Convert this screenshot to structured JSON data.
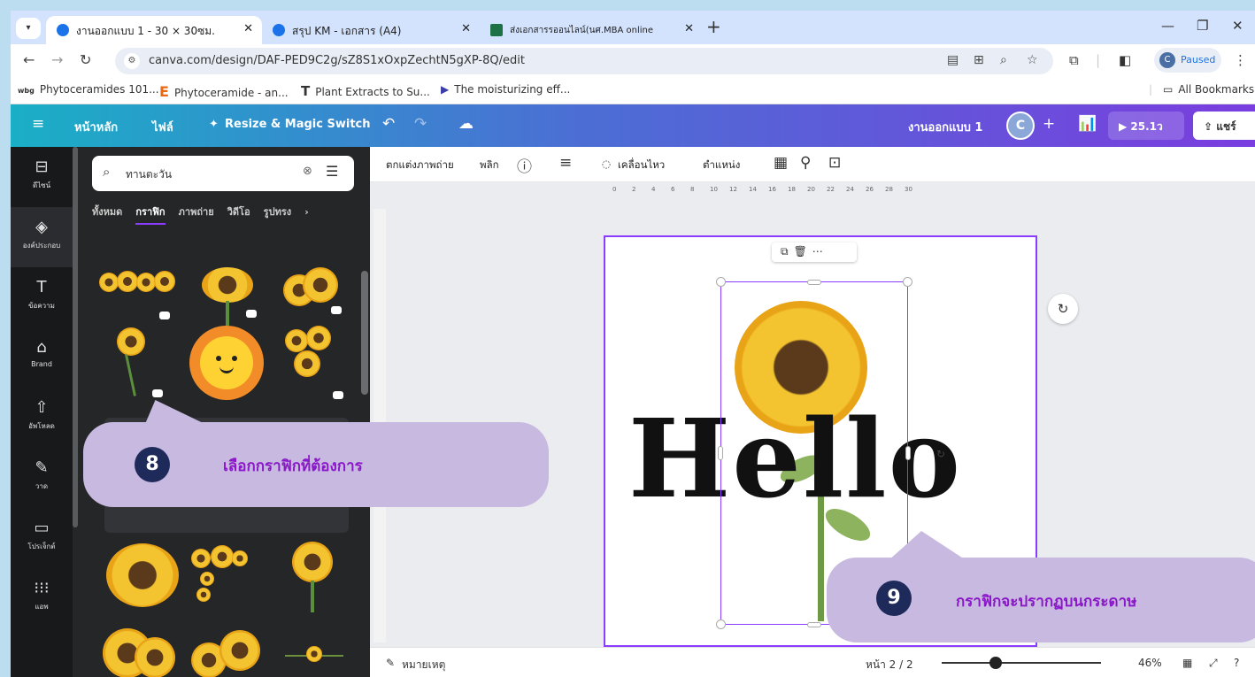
{
  "browser": {
    "tabs": [
      {
        "title": "งานออกแบบ 1 - 30 × 30ซม.",
        "active": true
      },
      {
        "title": "สรุป KM - เอกสาร (A4)",
        "active": false
      },
      {
        "title": "ส่งเอกสารรออนไลน์(นศ.MBA online",
        "active": false
      }
    ],
    "url": "canva.com/design/DAF-PED9C2g/sZ8S1xOxpZechtN5gXP-8Q/edit",
    "profile_status": "Paused",
    "profile_initial": "C",
    "bookmarks": [
      {
        "icon": "wbg",
        "label": "Phytoceramides 101..."
      },
      {
        "icon": "E",
        "label": "Phytoceramide - an..."
      },
      {
        "icon": "T",
        "label": "Plant Extracts to Su..."
      },
      {
        "icon": "▶",
        "label": "The moisturizing eff..."
      }
    ],
    "all_bookmarks": "All Bookmarks"
  },
  "canva": {
    "header": {
      "home": "หน้าหลัก",
      "file": "ไฟล์",
      "resize": "Resize & Magic Switch",
      "design_name": "งานออกแบบ 1",
      "avatar_initial": "C",
      "timer": "25.1ว",
      "share": "แชร์"
    },
    "rail": [
      {
        "icon": "template-icon",
        "label": "ดีไซน์"
      },
      {
        "icon": "elements-icon",
        "label": "องค์ประกอบ",
        "active": true
      },
      {
        "icon": "text-icon",
        "label": "ข้อความ"
      },
      {
        "icon": "brand-icon",
        "label": "Brand"
      },
      {
        "icon": "upload-icon",
        "label": "อัพโหลด"
      },
      {
        "icon": "draw-icon",
        "label": "วาด"
      },
      {
        "icon": "projects-icon",
        "label": "โปรเจ็กต์"
      },
      {
        "icon": "apps-icon",
        "label": "แอพ"
      }
    ],
    "search": {
      "value": "ทานตะวัน"
    },
    "categories": [
      "ทั้งหมด",
      "กราฟิก",
      "ภาพถ่าย",
      "วิดีโอ",
      "รูปทรง"
    ],
    "active_category": "กราฟิก",
    "toolbar": {
      "edit_photo": "ตกแต่งภาพถ่าย",
      "flip": "พลิก",
      "animate": "เคลื่อนไหว",
      "position": "ตำแหน่ง"
    },
    "ruler_ticks": [
      "0",
      "2",
      "4",
      "6",
      "8",
      "10",
      "12",
      "14",
      "16",
      "18",
      "20",
      "22",
      "24",
      "26",
      "28",
      "30"
    ],
    "canvas_text": "Hello",
    "footer": {
      "notes": "หมายเหตุ",
      "page": "หน้า 2 / 2",
      "zoom": "46%"
    }
  },
  "callouts": [
    {
      "number": "8",
      "text": "เลือกกราฟิกที่ต้องการ"
    },
    {
      "number": "9",
      "text": "กราฟิกจะปรากฏบนกระดาษ"
    }
  ],
  "colors": {
    "canva_gradient_start": "#1aafc6",
    "canva_gradient_end": "#7a3ddf",
    "selection": "#8b3dff",
    "callout_bg": "#c8b9e0",
    "callout_text": "#8b18c8",
    "badge_bg": "#1e2a5a"
  }
}
